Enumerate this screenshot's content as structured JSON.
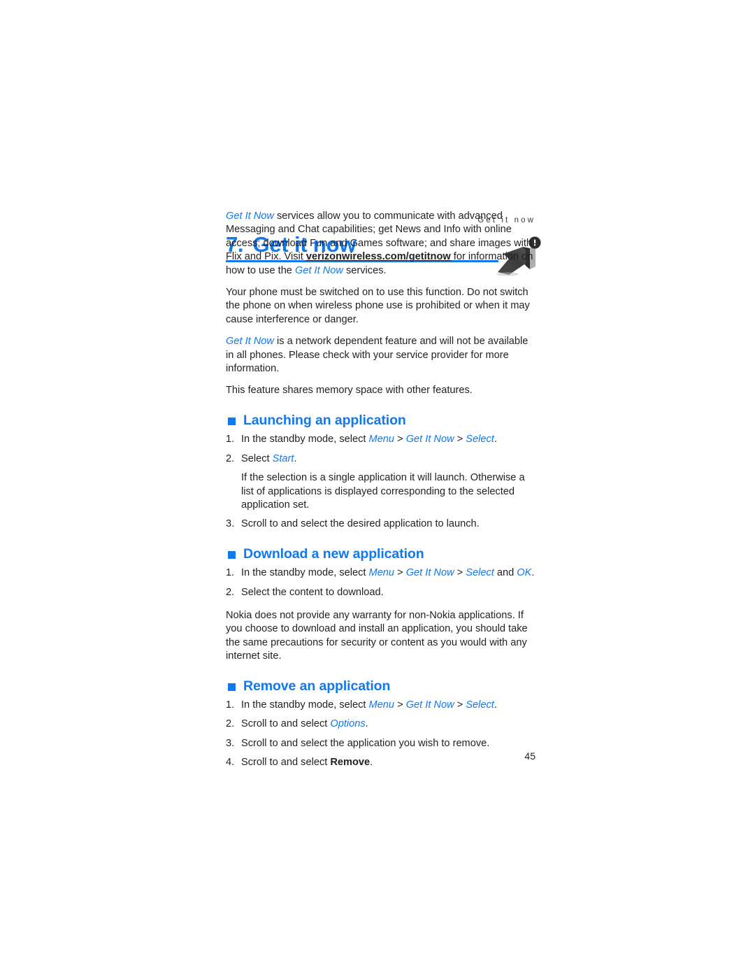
{
  "page": {
    "running_header": "Get it now",
    "page_number": "45",
    "accent_color": "#1178ee",
    "text_color": "#231f20"
  },
  "chapter": {
    "number": "7.",
    "title": "Get it now",
    "icon": "arrow-up-right-badge-icon"
  },
  "intro": {
    "p1": {
      "seg1": "Get It Now",
      "seg2": " services allow you to communicate with advanced Messaging and Chat capabilities; get News and Info with online access; download Fun and Games software; and share images with Flix and Pix. Visit ",
      "seg3": "verizonwireless.com/getitnow",
      "seg4": " for information on how to use the ",
      "seg5": "Get It Now",
      "seg6": " services."
    },
    "p2": "Your phone must be switched on to use this function. Do not switch the phone on when wireless phone use is prohibited or when it may cause interference or danger.",
    "p3": {
      "seg1": "Get It Now",
      "seg2": " is a network dependent feature and will not be available in all phones. Please check with your service provider for more information."
    },
    "p4": "This feature shares memory space with other features."
  },
  "sections": [
    {
      "heading": "Launching an application",
      "steps": [
        {
          "marker": "1.",
          "seg1": "In the standby mode, select ",
          "ui1": "Menu",
          "sep1": " > ",
          "ui2": "Get It Now",
          "sep2": " > ",
          "ui3": "Select",
          "tail": "."
        },
        {
          "marker": "2.",
          "seg1": "Select ",
          "ui1": "Start",
          "tail": ".",
          "note": "If the selection is a single application it will launch. Otherwise a list of applications is displayed corresponding to the selected application set."
        },
        {
          "marker": "3.",
          "seg1": "Scroll to and select the desired application to launch.",
          "tail": ""
        }
      ]
    },
    {
      "heading": "Download a new application",
      "steps": [
        {
          "marker": "1.",
          "seg1": "In the standby mode, select ",
          "ui1": "Menu",
          "sep1": " > ",
          "ui2": "Get It Now",
          "sep2": " > ",
          "ui3": "Select",
          "sep3": " and ",
          "ui4": "OK",
          "tail": "."
        },
        {
          "marker": "2.",
          "seg1": "Select the content to download.",
          "tail": ""
        }
      ],
      "after_note": "Nokia does not provide any warranty for non-Nokia applications. If you choose to download and install an application, you should take the same precautions for security or content as you would with any internet site."
    },
    {
      "heading": "Remove an application",
      "steps": [
        {
          "marker": "1.",
          "seg1": "In the standby mode, select ",
          "ui1": "Menu",
          "sep1": " > ",
          "ui2": "Get It Now",
          "sep2": " > ",
          "ui3": "Select",
          "tail": "."
        },
        {
          "marker": "2.",
          "seg1": "Scroll to and select ",
          "ui1": "Options",
          "tail": "."
        },
        {
          "marker": "3.",
          "seg1": "Scroll to and select the application you wish to remove.",
          "tail": ""
        },
        {
          "marker": "4.",
          "seg1": "Scroll to and select ",
          "bold1": "Remove",
          "tail": "."
        }
      ]
    }
  ]
}
